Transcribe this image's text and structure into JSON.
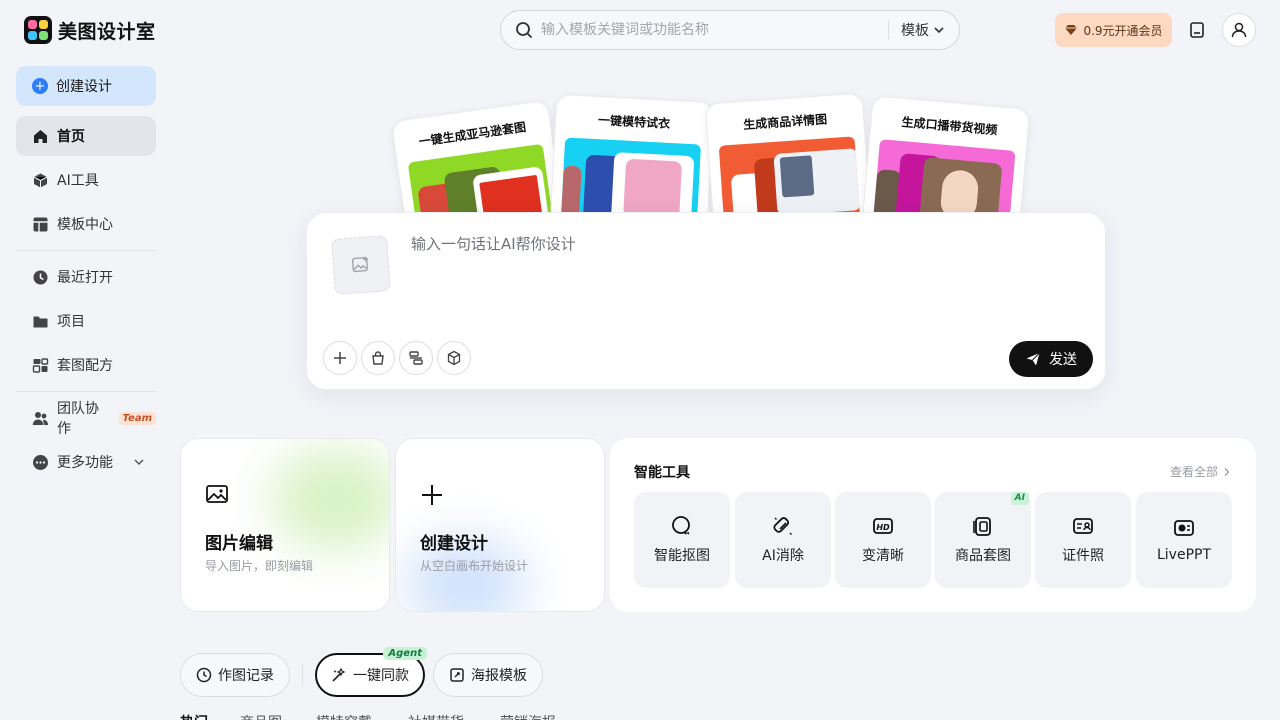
{
  "app": {
    "name": "美图设计室"
  },
  "search": {
    "placeholder": "输入模板关键词或功能名称",
    "scope": "模板"
  },
  "header": {
    "vip_label": "0.9元开通会员"
  },
  "sidebar": {
    "create_label": "创建设计",
    "items": [
      {
        "label": "首页",
        "icon": "home-icon",
        "active": true
      },
      {
        "label": "AI工具",
        "icon": "cube-icon"
      },
      {
        "label": "模板中心",
        "icon": "template-icon"
      },
      {
        "label": "最近打开",
        "icon": "clock-icon"
      },
      {
        "label": "项目",
        "icon": "folder-icon"
      },
      {
        "label": "套图配方",
        "icon": "recipe-icon"
      },
      {
        "label": "团队协作",
        "icon": "team-icon",
        "badge": "Team"
      },
      {
        "label": "更多功能",
        "icon": "more-icon"
      }
    ]
  },
  "hero": {
    "cards": [
      {
        "title": "一键生成亚马逊套图",
        "color": "#8fd926"
      },
      {
        "title": "一键模特试衣",
        "color": "#17d1f2"
      },
      {
        "title": "生成商品详情图",
        "color": "#f25c35"
      },
      {
        "title": "生成口播带货视频",
        "color": "#f56ad6"
      }
    ]
  },
  "prompt": {
    "placeholder": "输入一句话让AI帮你设计",
    "send_label": "发送"
  },
  "features": [
    {
      "title": "图片编辑",
      "subtitle": "导入图片，即刻编辑"
    },
    {
      "title": "创建设计",
      "subtitle": "从空白画布开始设计"
    }
  ],
  "smart_tools": {
    "title": "智能工具",
    "view_all": "查看全部",
    "items": [
      {
        "label": "智能抠图",
        "icon": "cutout-icon"
      },
      {
        "label": "AI消除",
        "icon": "eraser-icon"
      },
      {
        "label": "变清晰",
        "icon": "hd-icon"
      },
      {
        "label": "商品套图",
        "icon": "product-set-icon",
        "badge": "AI"
      },
      {
        "label": "证件照",
        "icon": "id-photo-icon"
      },
      {
        "label": "LivePPT",
        "icon": "ppt-icon"
      }
    ]
  },
  "bottom_tabs": [
    {
      "label": "作图记录",
      "icon": "history-icon"
    },
    {
      "label": "一键同款",
      "icon": "magic-icon",
      "badge": "Agent",
      "selected": true
    },
    {
      "label": "海报模板",
      "icon": "poster-icon"
    }
  ],
  "sub_tabs": [
    "热门",
    "商品图",
    "模特穿戴",
    "社媒带货",
    "营销海报"
  ]
}
